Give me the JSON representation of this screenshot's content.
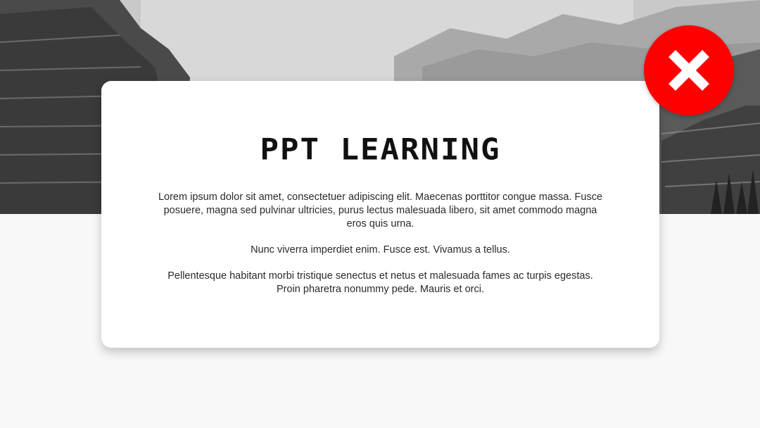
{
  "slide": {
    "title": "PPT LEARNING",
    "paragraphs": [
      "Lorem ipsum dolor sit amet, consectetuer adipiscing elit. Maecenas porttitor congue massa. Fusce posuere, magna sed pulvinar ultricies, purus lectus malesuada libero, sit amet commodo magna eros quis urna.",
      "Nunc viverra imperdiet enim. Fusce est. Vivamus a tellus.",
      "Pellentesque habitant morbi tristique senectus et netus et malesuada fames ac turpis egestas. Proin pharetra nonummy pede. Mauris et orci."
    ]
  },
  "close_button": {
    "icon": "close-icon",
    "color": "#ff0000"
  },
  "banner": {
    "image": "snowy-mountain-photo-grayscale"
  }
}
